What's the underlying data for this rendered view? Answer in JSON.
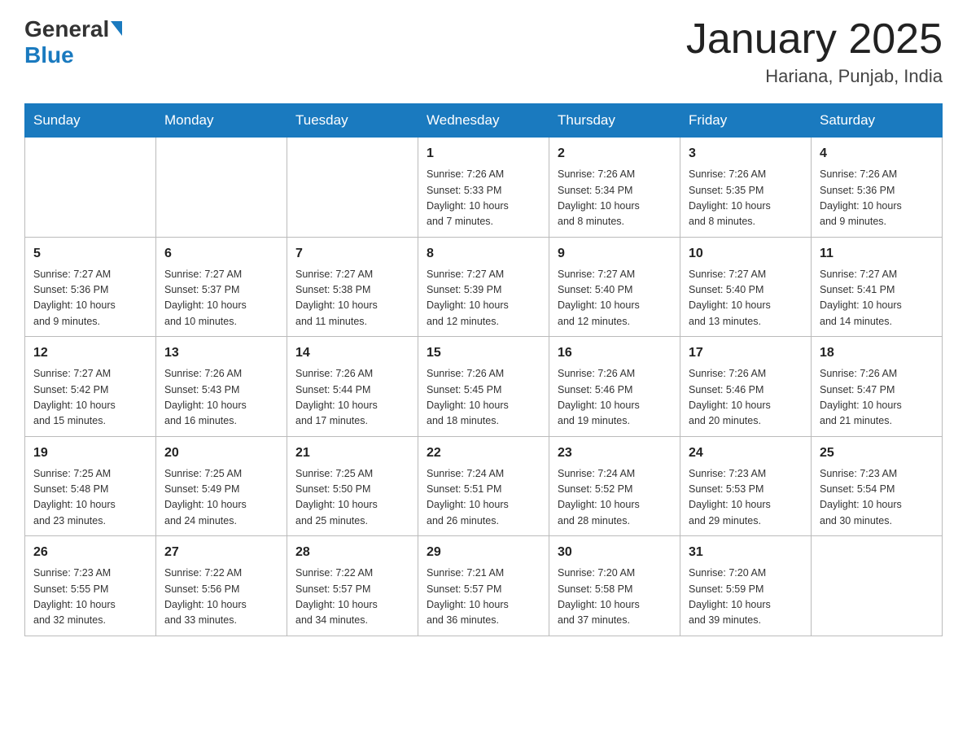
{
  "logo": {
    "general_text": "General",
    "blue_text": "Blue"
  },
  "header": {
    "month": "January 2025",
    "location": "Hariana, Punjab, India"
  },
  "weekdays": [
    "Sunday",
    "Monday",
    "Tuesday",
    "Wednesday",
    "Thursday",
    "Friday",
    "Saturday"
  ],
  "weeks": [
    [
      {
        "day": "",
        "info": ""
      },
      {
        "day": "",
        "info": ""
      },
      {
        "day": "",
        "info": ""
      },
      {
        "day": "1",
        "info": "Sunrise: 7:26 AM\nSunset: 5:33 PM\nDaylight: 10 hours\nand 7 minutes."
      },
      {
        "day": "2",
        "info": "Sunrise: 7:26 AM\nSunset: 5:34 PM\nDaylight: 10 hours\nand 8 minutes."
      },
      {
        "day": "3",
        "info": "Sunrise: 7:26 AM\nSunset: 5:35 PM\nDaylight: 10 hours\nand 8 minutes."
      },
      {
        "day": "4",
        "info": "Sunrise: 7:26 AM\nSunset: 5:36 PM\nDaylight: 10 hours\nand 9 minutes."
      }
    ],
    [
      {
        "day": "5",
        "info": "Sunrise: 7:27 AM\nSunset: 5:36 PM\nDaylight: 10 hours\nand 9 minutes."
      },
      {
        "day": "6",
        "info": "Sunrise: 7:27 AM\nSunset: 5:37 PM\nDaylight: 10 hours\nand 10 minutes."
      },
      {
        "day": "7",
        "info": "Sunrise: 7:27 AM\nSunset: 5:38 PM\nDaylight: 10 hours\nand 11 minutes."
      },
      {
        "day": "8",
        "info": "Sunrise: 7:27 AM\nSunset: 5:39 PM\nDaylight: 10 hours\nand 12 minutes."
      },
      {
        "day": "9",
        "info": "Sunrise: 7:27 AM\nSunset: 5:40 PM\nDaylight: 10 hours\nand 12 minutes."
      },
      {
        "day": "10",
        "info": "Sunrise: 7:27 AM\nSunset: 5:40 PM\nDaylight: 10 hours\nand 13 minutes."
      },
      {
        "day": "11",
        "info": "Sunrise: 7:27 AM\nSunset: 5:41 PM\nDaylight: 10 hours\nand 14 minutes."
      }
    ],
    [
      {
        "day": "12",
        "info": "Sunrise: 7:27 AM\nSunset: 5:42 PM\nDaylight: 10 hours\nand 15 minutes."
      },
      {
        "day": "13",
        "info": "Sunrise: 7:26 AM\nSunset: 5:43 PM\nDaylight: 10 hours\nand 16 minutes."
      },
      {
        "day": "14",
        "info": "Sunrise: 7:26 AM\nSunset: 5:44 PM\nDaylight: 10 hours\nand 17 minutes."
      },
      {
        "day": "15",
        "info": "Sunrise: 7:26 AM\nSunset: 5:45 PM\nDaylight: 10 hours\nand 18 minutes."
      },
      {
        "day": "16",
        "info": "Sunrise: 7:26 AM\nSunset: 5:46 PM\nDaylight: 10 hours\nand 19 minutes."
      },
      {
        "day": "17",
        "info": "Sunrise: 7:26 AM\nSunset: 5:46 PM\nDaylight: 10 hours\nand 20 minutes."
      },
      {
        "day": "18",
        "info": "Sunrise: 7:26 AM\nSunset: 5:47 PM\nDaylight: 10 hours\nand 21 minutes."
      }
    ],
    [
      {
        "day": "19",
        "info": "Sunrise: 7:25 AM\nSunset: 5:48 PM\nDaylight: 10 hours\nand 23 minutes."
      },
      {
        "day": "20",
        "info": "Sunrise: 7:25 AM\nSunset: 5:49 PM\nDaylight: 10 hours\nand 24 minutes."
      },
      {
        "day": "21",
        "info": "Sunrise: 7:25 AM\nSunset: 5:50 PM\nDaylight: 10 hours\nand 25 minutes."
      },
      {
        "day": "22",
        "info": "Sunrise: 7:24 AM\nSunset: 5:51 PM\nDaylight: 10 hours\nand 26 minutes."
      },
      {
        "day": "23",
        "info": "Sunrise: 7:24 AM\nSunset: 5:52 PM\nDaylight: 10 hours\nand 28 minutes."
      },
      {
        "day": "24",
        "info": "Sunrise: 7:23 AM\nSunset: 5:53 PM\nDaylight: 10 hours\nand 29 minutes."
      },
      {
        "day": "25",
        "info": "Sunrise: 7:23 AM\nSunset: 5:54 PM\nDaylight: 10 hours\nand 30 minutes."
      }
    ],
    [
      {
        "day": "26",
        "info": "Sunrise: 7:23 AM\nSunset: 5:55 PM\nDaylight: 10 hours\nand 32 minutes."
      },
      {
        "day": "27",
        "info": "Sunrise: 7:22 AM\nSunset: 5:56 PM\nDaylight: 10 hours\nand 33 minutes."
      },
      {
        "day": "28",
        "info": "Sunrise: 7:22 AM\nSunset: 5:57 PM\nDaylight: 10 hours\nand 34 minutes."
      },
      {
        "day": "29",
        "info": "Sunrise: 7:21 AM\nSunset: 5:57 PM\nDaylight: 10 hours\nand 36 minutes."
      },
      {
        "day": "30",
        "info": "Sunrise: 7:20 AM\nSunset: 5:58 PM\nDaylight: 10 hours\nand 37 minutes."
      },
      {
        "day": "31",
        "info": "Sunrise: 7:20 AM\nSunset: 5:59 PM\nDaylight: 10 hours\nand 39 minutes."
      },
      {
        "day": "",
        "info": ""
      }
    ]
  ]
}
